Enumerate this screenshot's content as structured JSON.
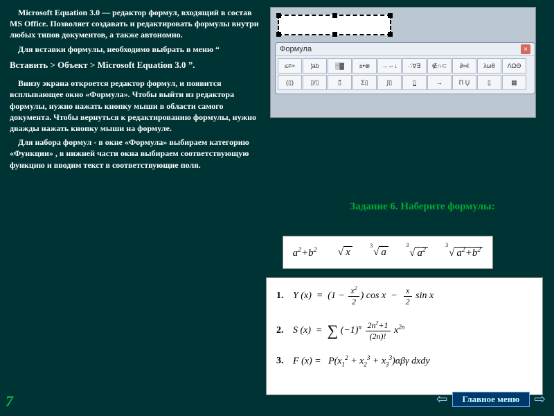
{
  "para1": "Microsoft Equation 3.0 — редактор формул, входящий в состав MS Office. Позволяет создавать и редактировать формулы внутри любых типов документов, а также автономно.",
  "para2": "Для вставки формулы, необходимо выбрать в меню “",
  "menu_path": "Вставить > Объект > Microsoft Equation 3.0  ”.",
  "para3": "Внизу экрана откроется редактор формул, и появится всплывающее окно «Формула». Чтобы выйти из редактора формулы, нужно нажать кнопку мыши в области самого документа. Чтобы вернуться к редактированию формулы, нужно дважды нажать кнопку мыши на формуле.",
  "para4": "Для набора формул  -  в окне «Формула» выбираем категорию «Функции» , в нижней части окна выбираем соответствующую функцию и вводим текст в соответствующие поля.",
  "toolbar_title": "Формула",
  "toolbar_rows": [
    [
      "≤≠≈",
      "¦ab",
      "▒▓",
      "±•⊗",
      "→⇔↓",
      "∴∀∃",
      "∉∩⊂",
      "∂∞ℓ",
      "λωθ",
      "ΛΩΘ"
    ],
    [
      "(▯)",
      "▯/▯",
      "▯̄",
      "Σ▯",
      "∫▯",
      "▯̲",
      "→",
      "Π Ų",
      "▯̣",
      "▦"
    ]
  ],
  "task_heading": "Задание 6. Наберите формулы:",
  "strip": {
    "f1": {
      "plain": "a² + b²"
    },
    "f2": {
      "root": "x"
    },
    "f3": {
      "deg": "3",
      "root": "a"
    },
    "f4": {
      "deg": "3",
      "root": "a²"
    },
    "f5": {
      "deg": "3",
      "root": "a² + b²"
    }
  },
  "formulas": [
    {
      "n": "1.",
      "lhs": "Y (x) = ",
      "body": "(1 − x²/2) cos x − x/2 sin x"
    },
    {
      "n": "2.",
      "lhs": "S (x) = ",
      "body": "Σ (−1)ⁿ (2n²+1)/(2n)! x²ⁿ"
    },
    {
      "n": "3.",
      "lhs": "F (x) = ",
      "body": "P(x₁² + x₂³ + x₃³) αβγ dxdy"
    }
  ],
  "page_number": "7",
  "nav": {
    "prev": "⇦",
    "menu": "Главное меню",
    "next": "⇨"
  }
}
